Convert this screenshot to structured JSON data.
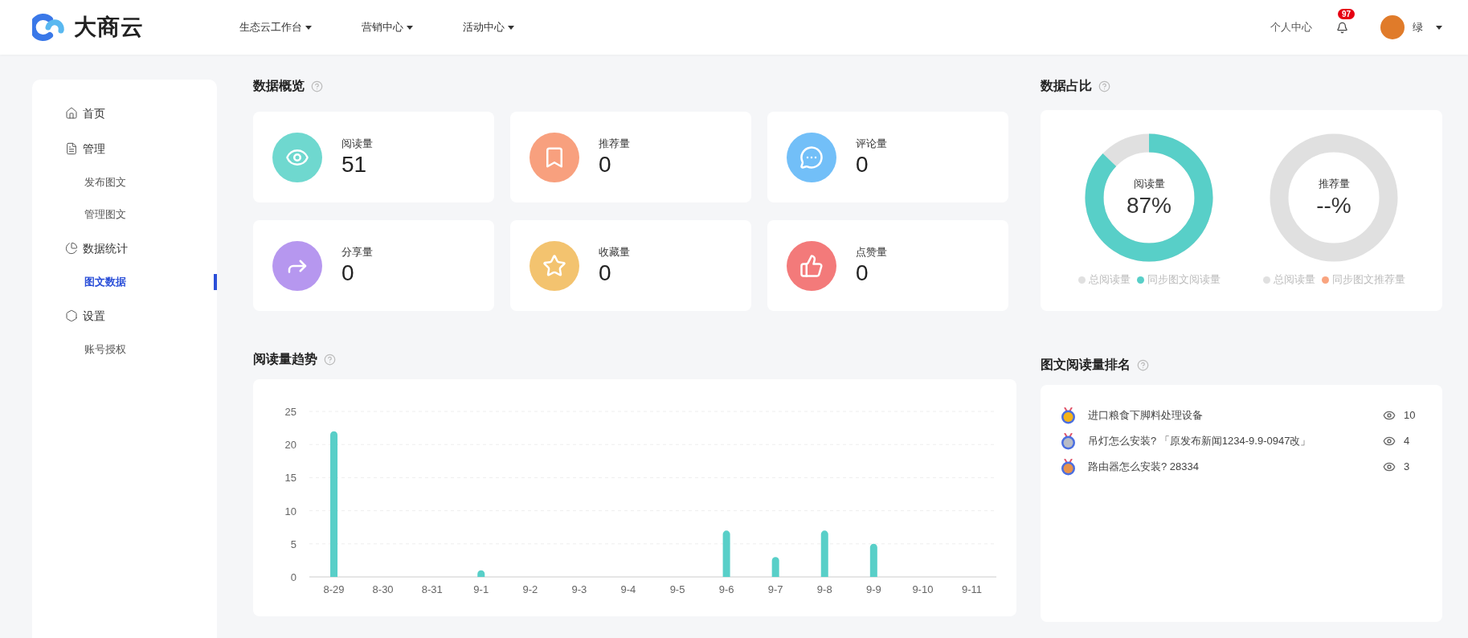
{
  "header": {
    "logo": "大商云",
    "nav": [
      {
        "label": "生态云工作台"
      },
      {
        "label": "营销中心"
      },
      {
        "label": "活动中心"
      }
    ],
    "personal_center": "个人中心",
    "notification_badge": "97",
    "user_name": "绿"
  },
  "sidebar": {
    "items": [
      {
        "label": "首页",
        "kind": "home",
        "selected": false
      },
      {
        "label": "管理",
        "kind": "manage",
        "selected": false,
        "children": [
          {
            "label": "发布图文",
            "selected": false
          },
          {
            "label": "管理图文",
            "selected": false
          }
        ]
      },
      {
        "label": "数据统计",
        "kind": "stats",
        "selected": false,
        "children": [
          {
            "label": "图文数据",
            "selected": true
          }
        ]
      },
      {
        "label": "设置",
        "kind": "settings",
        "selected": false,
        "children": [
          {
            "label": "账号授权",
            "selected": false
          }
        ]
      }
    ]
  },
  "overview": {
    "title": "数据概览",
    "stats": [
      {
        "label": "阅读量",
        "value": "51",
        "color": "#6fd8cf"
      },
      {
        "label": "推荐量",
        "value": "0",
        "color": "#f8a07e"
      },
      {
        "label": "评论量",
        "value": "0",
        "color": "#72bff8"
      },
      {
        "label": "分享量",
        "value": "0",
        "color": "#b697ef"
      },
      {
        "label": "收藏量",
        "value": "0",
        "color": "#f3c36f"
      },
      {
        "label": "点赞量",
        "value": "0",
        "color": "#f37a7a"
      }
    ]
  },
  "ratio": {
    "title": "数据占比",
    "donuts": [
      {
        "label": "阅读量",
        "value": "87%",
        "level": 0.87,
        "legend": [
          {
            "label": "总阅读量",
            "color": "#e0e0e0"
          },
          {
            "label": "同步图文阅读量",
            "color": "#58cfc8"
          }
        ]
      },
      {
        "label": "推荐量",
        "value": "--%",
        "legend": [
          {
            "label": "总阅读量",
            "color": "#e0e0e0"
          },
          {
            "label": "同步图文推荐量",
            "color": "#f9a47f"
          }
        ]
      }
    ]
  },
  "trend": {
    "title": "阅读量趋势",
    "chart_data": {
      "type": "bar",
      "categories": [
        "8-29",
        "8-30",
        "8-31",
        "9-1",
        "9-2",
        "9-3",
        "9-4",
        "9-5",
        "9-6",
        "9-7",
        "9-8",
        "9-9",
        "9-10",
        "9-11"
      ],
      "grid": true,
      "series": [
        {
          "color": "#58cfc8",
          "values": [
            22,
            0,
            0,
            1,
            0,
            0,
            0,
            0,
            7,
            3,
            7,
            5,
            0,
            0
          ]
        }
      ],
      "ylim": [
        0,
        25
      ],
      "yticks": [
        0,
        5,
        10,
        15,
        20,
        25
      ]
    }
  },
  "ranking": {
    "title": "图文阅读量排名",
    "items": [
      {
        "title": "进口粮食下脚料处理设备",
        "views": "10"
      },
      {
        "title": "吊灯怎么安装? 「原发布新闻1234-9.9-0947改」",
        "views": "4"
      },
      {
        "title": "路由器怎么安装? 28334",
        "views": "3"
      }
    ]
  }
}
